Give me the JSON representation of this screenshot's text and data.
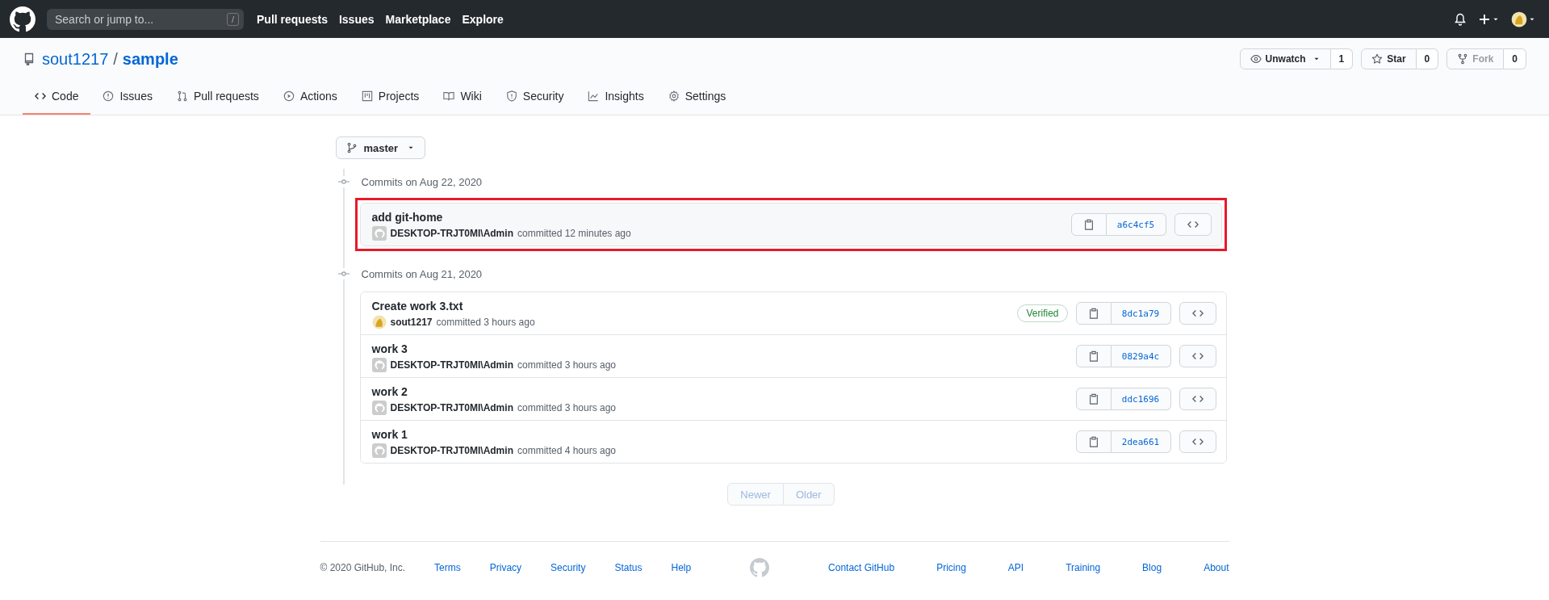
{
  "header": {
    "search_placeholder": "Search or jump to...",
    "search_key": "/",
    "nav": [
      "Pull requests",
      "Issues",
      "Marketplace",
      "Explore"
    ]
  },
  "repo": {
    "owner": "sout1217",
    "separator": "/",
    "name": "sample",
    "actions": [
      {
        "label": "Unwatch",
        "count": "1",
        "caret": true,
        "disabled": false
      },
      {
        "label": "Star",
        "count": "0",
        "caret": false,
        "disabled": false
      },
      {
        "label": "Fork",
        "count": "0",
        "caret": false,
        "disabled": true
      }
    ]
  },
  "tabs": [
    {
      "label": "Code",
      "selected": true
    },
    {
      "label": "Issues",
      "selected": false
    },
    {
      "label": "Pull requests",
      "selected": false
    },
    {
      "label": "Actions",
      "selected": false
    },
    {
      "label": "Projects",
      "selected": false
    },
    {
      "label": "Wiki",
      "selected": false
    },
    {
      "label": "Security",
      "selected": false
    },
    {
      "label": "Insights",
      "selected": false
    },
    {
      "label": "Settings",
      "selected": false
    }
  ],
  "branch": "master",
  "commit_groups": [
    {
      "date": "Commits on Aug 22, 2020",
      "commits": [
        {
          "title": "add git-home",
          "kind": "identicon",
          "author": "DESKTOP-TRJT0MI\\Admin",
          "time": "committed 12 minutes ago",
          "sha": "a6c4cf5",
          "highlighted": true
        }
      ]
    },
    {
      "date": "Commits on Aug 21, 2020",
      "commits": [
        {
          "title": "Create work 3.txt",
          "kind": "user",
          "author": "sout1217",
          "time": "committed 3 hours ago",
          "verified": "Verified",
          "sha": "8dc1a79",
          "highlighted": false
        },
        {
          "title": "work 3",
          "kind": "identicon",
          "author": "DESKTOP-TRJT0MI\\Admin",
          "time": "committed 3 hours ago",
          "sha": "0829a4c",
          "highlighted": false
        },
        {
          "title": "work 2",
          "kind": "identicon",
          "author": "DESKTOP-TRJT0MI\\Admin",
          "time": "committed 3 hours ago",
          "sha": "ddc1696",
          "highlighted": false
        },
        {
          "title": "work 1",
          "kind": "identicon",
          "author": "DESKTOP-TRJT0MI\\Admin",
          "time": "committed 4 hours ago",
          "sha": "2dea661",
          "highlighted": false
        }
      ]
    }
  ],
  "pagination": [
    {
      "label": "Newer",
      "disabled": true
    },
    {
      "label": "Older",
      "disabled": true
    }
  ],
  "footer": {
    "copyright": "© 2020 GitHub, Inc.",
    "left_links": [
      "Terms",
      "Privacy",
      "Security",
      "Status",
      "Help"
    ],
    "right_links": [
      "Contact GitHub",
      "Pricing",
      "API",
      "Training",
      "Blog",
      "About"
    ]
  }
}
